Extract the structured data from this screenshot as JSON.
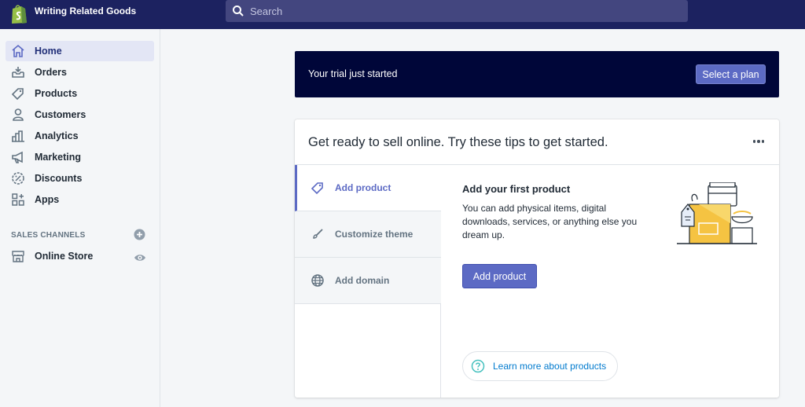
{
  "topbar": {
    "store_name": "Writing Related Goods",
    "search_placeholder": "Search"
  },
  "sidebar": {
    "items": [
      {
        "label": "Home",
        "icon": "home-icon"
      },
      {
        "label": "Orders",
        "icon": "orders-icon"
      },
      {
        "label": "Products",
        "icon": "tag-icon"
      },
      {
        "label": "Customers",
        "icon": "person-icon"
      },
      {
        "label": "Analytics",
        "icon": "bar-chart-icon"
      },
      {
        "label": "Marketing",
        "icon": "megaphone-icon"
      },
      {
        "label": "Discounts",
        "icon": "discount-icon"
      },
      {
        "label": "Apps",
        "icon": "apps-icon"
      }
    ],
    "sales_channels_title": "SALES CHANNELS",
    "channels": [
      {
        "label": "Online Store",
        "icon": "store-icon"
      }
    ]
  },
  "trial": {
    "text": "Your trial just started",
    "button": "Select a plan"
  },
  "tips": {
    "title": "Get ready to sell online. Try these tips to get started.",
    "tabs": [
      {
        "label": "Add product",
        "icon": "tag-icon"
      },
      {
        "label": "Customize theme",
        "icon": "brush-icon"
      },
      {
        "label": "Add domain",
        "icon": "globe-icon"
      }
    ],
    "active": {
      "heading": "Add your first product",
      "body": "You can add physical items, digital downloads, services, or anything else you dream up.",
      "button": "Add product",
      "learn_more": "Learn more about products"
    }
  },
  "colors": {
    "topbar": "#1c2260",
    "accent": "#5c6ac4",
    "banner": "#000639",
    "link": "#007ace"
  }
}
